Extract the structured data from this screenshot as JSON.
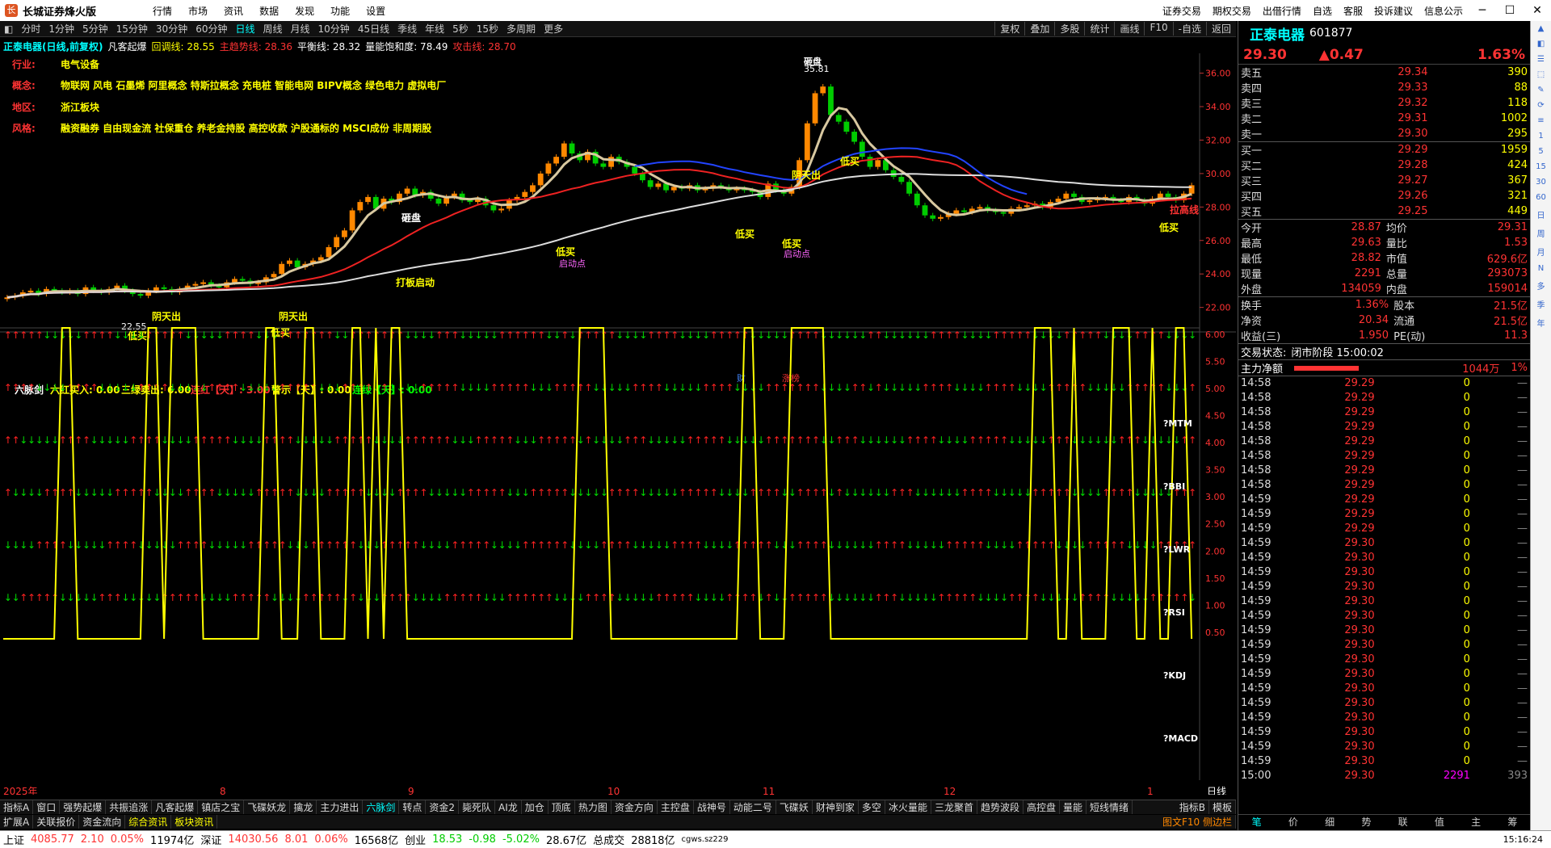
{
  "app": {
    "name": "长城证券烽火版",
    "menu": [
      "行情",
      "市场",
      "资讯",
      "数据",
      "发现",
      "功能",
      "设置"
    ],
    "right_menu": [
      "证券交易",
      "期权交易",
      "出借行情",
      "自选",
      "客服",
      "投诉建议",
      "信息公示"
    ]
  },
  "periods": {
    "items": [
      "分时",
      "1分钟",
      "5分钟",
      "15分钟",
      "30分钟",
      "60分钟",
      "日线",
      "周线",
      "月线",
      "10分钟",
      "45日线",
      "季线",
      "年线",
      "5秒",
      "15秒",
      "多周期",
      "更多"
    ],
    "active": "日线",
    "tools": [
      "复权",
      "叠加",
      "多股",
      "统计",
      "画线",
      "F10",
      "-自选",
      "返回"
    ]
  },
  "kline_info": {
    "stock": "正泰电器(日线,前复权)",
    "indicator": "凡客起爆",
    "hl": "回调线: 28.55",
    "zs": "主趋势线: 28.36",
    "ph": "平衡线: 28.32",
    "ln": "量能饱和度: 78.49",
    "gj": "攻击线: 28.70"
  },
  "info_lines": [
    {
      "label": "行业:",
      "value": "电气设备"
    },
    {
      "label": "概念:",
      "value": "物联网 风电 石墨烯 阿里概念 特斯拉概念 充电桩 智能电网 BIPV概念 绿色电力 虚拟电厂"
    },
    {
      "label": "地区:",
      "value": "浙江板块"
    },
    {
      "label": "风格:",
      "value": "融资融券 自由现金流 社保重仓 养老金持股 高控收款 沪股通标的 MSCI成份 非周期股"
    }
  ],
  "price_axis": [
    "36.00",
    "34.00",
    "32.00",
    "30.00",
    "28.00",
    "26.00",
    "24.00",
    "22.00"
  ],
  "annotations": {
    "low": "22.55",
    "high": "35.81",
    "top_label": "砸盘",
    "mid_label": "砸盘",
    "launch": "打板启动",
    "start": "启动点",
    "buy": "低买",
    "sun": "阴天出",
    "last": "拉高线",
    "cai": "财",
    "zt": "涨榜"
  },
  "sub_info": {
    "name": "六脉剑",
    "a": "六红买入: 0.00",
    "b": "三绿卖出: 6.00",
    "c": "连红【天】: 3.00",
    "d": "警示【天】: 0.00",
    "e": "连绿【天】: 0.00"
  },
  "sub_axis": [
    "6.00",
    "5.50",
    "5.00",
    "4.50",
    "4.00",
    "3.50",
    "3.00",
    "2.50",
    "2.00",
    "1.50",
    "1.00",
    "0.50"
  ],
  "sub_labels": [
    "?MTM",
    "?BBI",
    "?LWR",
    "?RSI",
    "?KDJ",
    "?MACD"
  ],
  "time_axis": [
    "2025年",
    "8",
    "9",
    "10",
    "11",
    "12",
    "1"
  ],
  "time_unit": "日线",
  "tabs1": [
    "指标A",
    "窗口",
    "强势起爆",
    "共振追涨",
    "凡客起爆",
    "镇店之宝",
    "飞碟妖龙",
    "擒龙",
    "主力进出",
    "六脉剑",
    "转点",
    "资金2",
    "毙死队",
    "AI龙",
    "加仓",
    "顶底",
    "热力图",
    "资金方向",
    "主控盘",
    "战神号",
    "动能二号",
    "飞碟妖",
    "财神到家",
    "多空",
    "冰火量能",
    "三龙聚首",
    "趋势波段",
    "高控盘",
    "量能",
    "短线情绪"
  ],
  "tabs1_active": "六脉剑",
  "tabs1_right": [
    "指标B",
    "模板"
  ],
  "tabs2": [
    "扩展A",
    "关联报价",
    "资金流向",
    "综合资讯",
    "板块资讯"
  ],
  "tabs2_f10": "图文F10 侧边栏",
  "stock": {
    "name": "正泰电器",
    "code": "601877",
    "price": "29.30",
    "change": "▲0.47",
    "pct": "1.63%"
  },
  "sells": [
    [
      "卖五",
      "29.34",
      "390"
    ],
    [
      "卖四",
      "29.33",
      "88"
    ],
    [
      "卖三",
      "29.32",
      "118"
    ],
    [
      "卖二",
      "29.31",
      "1002"
    ],
    [
      "卖一",
      "29.30",
      "295"
    ]
  ],
  "buys": [
    [
      "买一",
      "29.29",
      "1959"
    ],
    [
      "买二",
      "29.28",
      "424"
    ],
    [
      "买三",
      "29.27",
      "367"
    ],
    [
      "买四",
      "29.26",
      "321"
    ],
    [
      "买五",
      "29.25",
      "449"
    ]
  ],
  "stats": [
    [
      "今开",
      "28.87",
      "均价",
      "29.31"
    ],
    [
      "最高",
      "29.63",
      "量比",
      "1.53"
    ],
    [
      "最低",
      "28.82",
      "市值",
      "629.6亿"
    ],
    [
      "现量",
      "2291",
      "总量",
      "293073"
    ],
    [
      "外盘",
      "134059",
      "内盘",
      "159014"
    ]
  ],
  "stats2": [
    [
      "换手",
      "1.36%",
      "股本",
      "21.5亿"
    ],
    [
      "净资",
      "20.34",
      "流通",
      "21.5亿"
    ],
    [
      "收益(三)",
      "1.950",
      "PE(动)",
      "11.3"
    ]
  ],
  "trade_status": {
    "label": "交易状态:",
    "value": "闭市阶段 15:00:02"
  },
  "main_net": {
    "label": "主力净额",
    "value": "1044万",
    "pct": "1%"
  },
  "ticks": [
    [
      "14:58",
      "29.29",
      "0"
    ],
    [
      "14:58",
      "29.29",
      "0"
    ],
    [
      "14:58",
      "29.29",
      "0"
    ],
    [
      "14:58",
      "29.29",
      "0"
    ],
    [
      "14:58",
      "29.29",
      "0"
    ],
    [
      "14:58",
      "29.29",
      "0"
    ],
    [
      "14:58",
      "29.29",
      "0"
    ],
    [
      "14:58",
      "29.29",
      "0"
    ],
    [
      "14:59",
      "29.29",
      "0"
    ],
    [
      "14:59",
      "29.29",
      "0"
    ],
    [
      "14:59",
      "29.29",
      "0"
    ],
    [
      "14:59",
      "29.30",
      "0"
    ],
    [
      "14:59",
      "29.30",
      "0"
    ],
    [
      "14:59",
      "29.30",
      "0"
    ],
    [
      "14:59",
      "29.30",
      "0"
    ],
    [
      "14:59",
      "29.30",
      "0"
    ],
    [
      "14:59",
      "29.30",
      "0"
    ],
    [
      "14:59",
      "29.30",
      "0"
    ],
    [
      "14:59",
      "29.30",
      "0"
    ],
    [
      "14:59",
      "29.30",
      "0"
    ],
    [
      "14:59",
      "29.30",
      "0"
    ],
    [
      "14:59",
      "29.30",
      "0"
    ],
    [
      "14:59",
      "29.30",
      "0"
    ],
    [
      "14:59",
      "29.30",
      "0"
    ],
    [
      "14:59",
      "29.30",
      "0"
    ],
    [
      "14:59",
      "29.30",
      "0"
    ],
    [
      "14:59",
      "29.30",
      "0"
    ],
    [
      "15:00",
      "29.30",
      "2291"
    ]
  ],
  "tick_last_extra": "393",
  "bottom_tabs": [
    "笔",
    "价",
    "细",
    "势",
    "联",
    "值",
    "主",
    "筹"
  ],
  "sidebar_items": [
    "1",
    "5",
    "15",
    "30",
    "60",
    "日",
    "周",
    "月",
    "N",
    "多",
    "季",
    "年"
  ],
  "statusbar": {
    "sh": "上证",
    "sh_val": "4085.77",
    "sh_chg": "2.10",
    "sh_pct": "0.05%",
    "sh_amt": "11974亿",
    "sz": "深证",
    "sz_val": "14030.56",
    "sz_chg": "8.01",
    "sz_pct": "0.06%",
    "sz_amt": "16568亿",
    "cy": "创业",
    "cy_val": "18.53",
    "cy_chg": "-0.98",
    "cy_pct": "-5.02%",
    "cy_amt": "28.67亿",
    "total": "总成交",
    "total_amt": "28818亿",
    "server": "cgws.sz229",
    "time": "15:16:24"
  },
  "colors": {
    "up": "#ff3333",
    "down": "#00cc00",
    "ma_red": "#ee2222",
    "ma_blue": "#2244ff",
    "ma_white": "#dddddd",
    "ma_tan": "#d8c8a0",
    "yellow": "#ffff00"
  },
  "chart_data": {
    "type": "candlestick",
    "title": "正泰电器(日线,前复权)",
    "ylim": [
      21.5,
      36.8
    ],
    "closes": [
      22.6,
      22.7,
      22.9,
      23.0,
      22.8,
      23.1,
      23.0,
      22.9,
      23.0,
      22.8,
      23.2,
      23.0,
      22.9,
      23.1,
      23.3,
      23.0,
      22.8,
      22.7,
      23.0,
      23.2,
      23.1,
      22.9,
      23.1,
      23.3,
      23.4,
      23.5,
      23.3,
      23.2,
      23.5,
      23.7,
      23.6,
      23.4,
      23.5,
      23.8,
      24.0,
      24.6,
      24.8,
      24.4,
      24.6,
      24.8,
      25.0,
      25.6,
      26.2,
      26.6,
      27.8,
      28.3,
      28.6,
      27.9,
      28.5,
      28.3,
      28.8,
      29.1,
      28.7,
      28.9,
      28.5,
      28.2,
      28.6,
      28.8,
      28.4,
      28.3,
      28.5,
      28.1,
      27.8,
      27.9,
      28.4,
      28.6,
      28.9,
      29.3,
      30.0,
      30.6,
      31.0,
      31.8,
      31.2,
      30.8,
      31.3,
      30.6,
      30.4,
      31.0,
      30.7,
      30.4,
      30.0,
      29.6,
      29.2,
      29.4,
      29.0,
      29.2,
      29.1,
      29.3,
      29.0,
      29.1,
      29.3,
      29.2,
      29.0,
      29.1,
      29.0,
      28.9,
      28.6,
      29.4,
      29.0,
      28.8,
      29.2,
      30.8,
      33.0,
      34.8,
      35.2,
      33.5,
      33.1,
      32.5,
      31.9,
      31.0,
      30.4,
      30.8,
      30.2,
      29.8,
      29.5,
      28.8,
      28.1,
      27.5,
      27.3,
      27.4,
      27.6,
      27.8,
      27.7,
      27.9,
      28.0,
      27.8,
      27.7,
      27.6,
      27.9,
      28.0,
      28.1,
      28.2,
      28.0,
      28.3,
      28.5,
      28.8,
      28.6,
      28.3,
      28.4,
      28.5,
      28.6,
      28.4,
      28.3,
      28.6,
      28.4,
      28.2,
      28.5,
      28.8,
      28.6,
      28.4,
      28.8,
      29.3
    ]
  }
}
